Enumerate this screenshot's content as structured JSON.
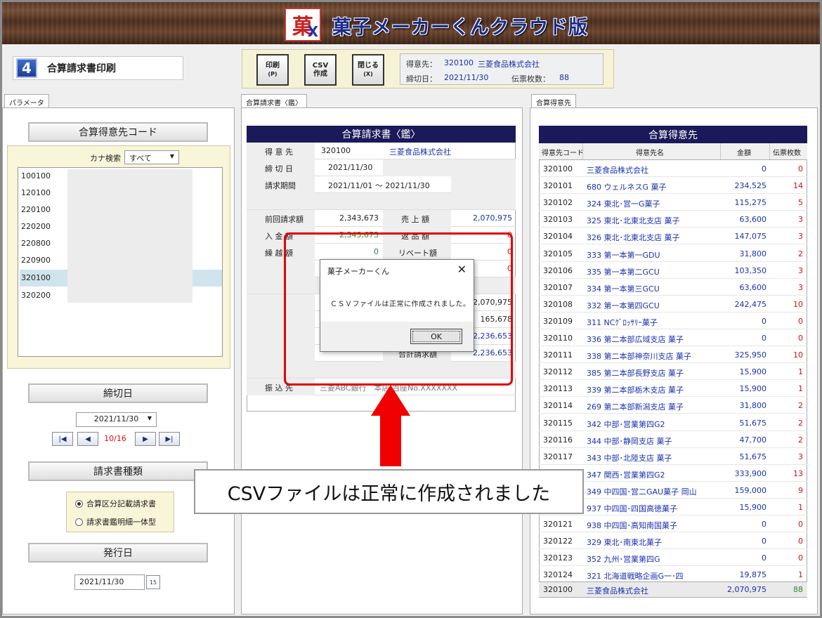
{
  "app": {
    "title": "菓子メーカーくんクラウド版",
    "logo_char": "菓",
    "logo_x": "X"
  },
  "screen": {
    "number": "4",
    "name": "合算請求書印刷"
  },
  "toolbar": {
    "print": {
      "label": "印刷",
      "key": "(P)"
    },
    "csv": {
      "label": "CSV",
      "sub": "作成"
    },
    "close": {
      "label": "閉じる",
      "key": "(X)"
    },
    "customer_label": "得意先：",
    "customer_code": "320100",
    "customer_name": "三菱食品株式会社",
    "cutoff_label": "締切日：",
    "cutoff_date": "2021/11/30",
    "slip_label": "伝票枚数：",
    "slip_count": "88"
  },
  "tabs": {
    "params": "パラメータ",
    "invoice": "合算請求書〈鑑〉",
    "customers": "合算得意先"
  },
  "params": {
    "code_header": "合算得意先コード",
    "kana_label": "カナ検索",
    "kana_value": "すべて",
    "codes": [
      "100100",
      "120100",
      "220100",
      "220200",
      "220800",
      "220900",
      "320100",
      "320200"
    ],
    "selected_code": "320100",
    "cutoff_header": "締切日",
    "cutoff_value": "2021/11/30",
    "nav_pos": "10/16",
    "type_header": "請求書種類",
    "type_opt1": "合算区分記載請求書",
    "type_opt2": "請求書鑑明細一体型",
    "issue_header": "発行日",
    "issue_value": "2021/11/30"
  },
  "invoice": {
    "title": "合算請求書〈鑑〉",
    "l_customer": "得 意 先",
    "customer_code": "320100",
    "customer_name": "三菱食品株式会社",
    "l_cutoff": "締 切 日",
    "cutoff": "2021/11/30",
    "l_period": "請求期間",
    "period": "2021/11/01 ～ 2021/11/30",
    "l_prev": "前回請求額",
    "prev": "2,343,673",
    "l_sales": "売 上 額",
    "sales": "2,070,975",
    "l_paid": "入 金 額",
    "paid": "2,343,673",
    "l_return": "返 品 額",
    "return": "0",
    "l_carry": "繰 越 額",
    "carry": "0",
    "l_rebate": "リベート額",
    "rebate": "0",
    "v_r3": "0",
    "v_r4": "2,070,975",
    "v_r5": "165,678",
    "v_r6": "2,236,653",
    "l_total": "合計請求額",
    "total": "2,236,653",
    "l_bank": "振 込 先",
    "bank": "三菱ABC銀行　本店 当座No.XXXXXXX"
  },
  "customers": {
    "title": "合算得意先",
    "h_code": "得意先コード",
    "h_name": "得意先名",
    "h_amount": "金額",
    "h_count": "伝票枚数",
    "rows": [
      {
        "code": "320100",
        "name": "三菱食品株式会社",
        "amount": "0",
        "count": "0"
      },
      {
        "code": "320101",
        "name": "680 ウェルネスG 菓子",
        "amount": "234,525",
        "count": "14"
      },
      {
        "code": "320102",
        "name": "324 東北･営一G菓子",
        "amount": "115,275",
        "count": "5"
      },
      {
        "code": "320103",
        "name": "325 東北･北東北支店 菓子",
        "amount": "63,600",
        "count": "3"
      },
      {
        "code": "320104",
        "name": "326 東北･北東北支店 菓子",
        "amount": "147,075",
        "count": "3"
      },
      {
        "code": "320105",
        "name": "333 第一本第一GDU",
        "amount": "31,800",
        "count": "2"
      },
      {
        "code": "320106",
        "name": "335 第一本第二GCU",
        "amount": "103,350",
        "count": "3"
      },
      {
        "code": "320107",
        "name": "334 第一本第三GCU",
        "amount": "63,600",
        "count": "3"
      },
      {
        "code": "320108",
        "name": "332 第一本第四GCU",
        "amount": "242,475",
        "count": "10"
      },
      {
        "code": "320109",
        "name": "311 NCｸﾞﾛｯｻﾘｰ菓子",
        "amount": "0",
        "count": "0"
      },
      {
        "code": "320110",
        "name": "336 第二本部広域支店 菓子",
        "amount": "0",
        "count": "0"
      },
      {
        "code": "320111",
        "name": "338 第二本部神奈川支店 菓子",
        "amount": "325,950",
        "count": "10"
      },
      {
        "code": "320112",
        "name": "385 第二本部長野支店 菓子",
        "amount": "15,900",
        "count": "1"
      },
      {
        "code": "320113",
        "name": "339 第二本部栃木支店 菓子",
        "amount": "15,900",
        "count": "1"
      },
      {
        "code": "320114",
        "name": "269 第二本部新潟支店 菓子",
        "amount": "31,800",
        "count": "2"
      },
      {
        "code": "320115",
        "name": "342 中部･営業第四G2",
        "amount": "51,675",
        "count": "2"
      },
      {
        "code": "320116",
        "name": "344 中部･静岡支店 菓子",
        "amount": "47,700",
        "count": "2"
      },
      {
        "code": "320117",
        "name": "343 中部･北陸支店 菓子",
        "amount": "51,675",
        "count": "3"
      },
      {
        "code": "320118",
        "name": "347 関西･営業第四G2",
        "amount": "333,900",
        "count": "13"
      },
      {
        "code": "320119",
        "name": "349 中四国･営二GAU菓子 岡山",
        "amount": "159,000",
        "count": "9"
      },
      {
        "code": "320120",
        "name": "937 中四国･四国高徳菓子",
        "amount": "15,900",
        "count": "1"
      },
      {
        "code": "320121",
        "name": "938 中四国･高知南国菓子",
        "amount": "0",
        "count": "0"
      },
      {
        "code": "320122",
        "name": "329 東北･南東北菓子",
        "amount": "0",
        "count": "0"
      },
      {
        "code": "320123",
        "name": "352 九州･営業第四G",
        "amount": "0",
        "count": "0"
      },
      {
        "code": "320124",
        "name": "321 北海道戦略企画G一･四",
        "amount": "19,875",
        "count": "1"
      }
    ],
    "footer": {
      "code": "320100",
      "name": "三菱食品株式会社",
      "amount": "2,070,975",
      "count": "88"
    }
  },
  "dialog": {
    "title": "菓子メーカーくん",
    "message": "ＣＳＶファイルは正常に作成されました。",
    "ok": "OK"
  },
  "caption": "CSVファイルは正常に作成されました"
}
